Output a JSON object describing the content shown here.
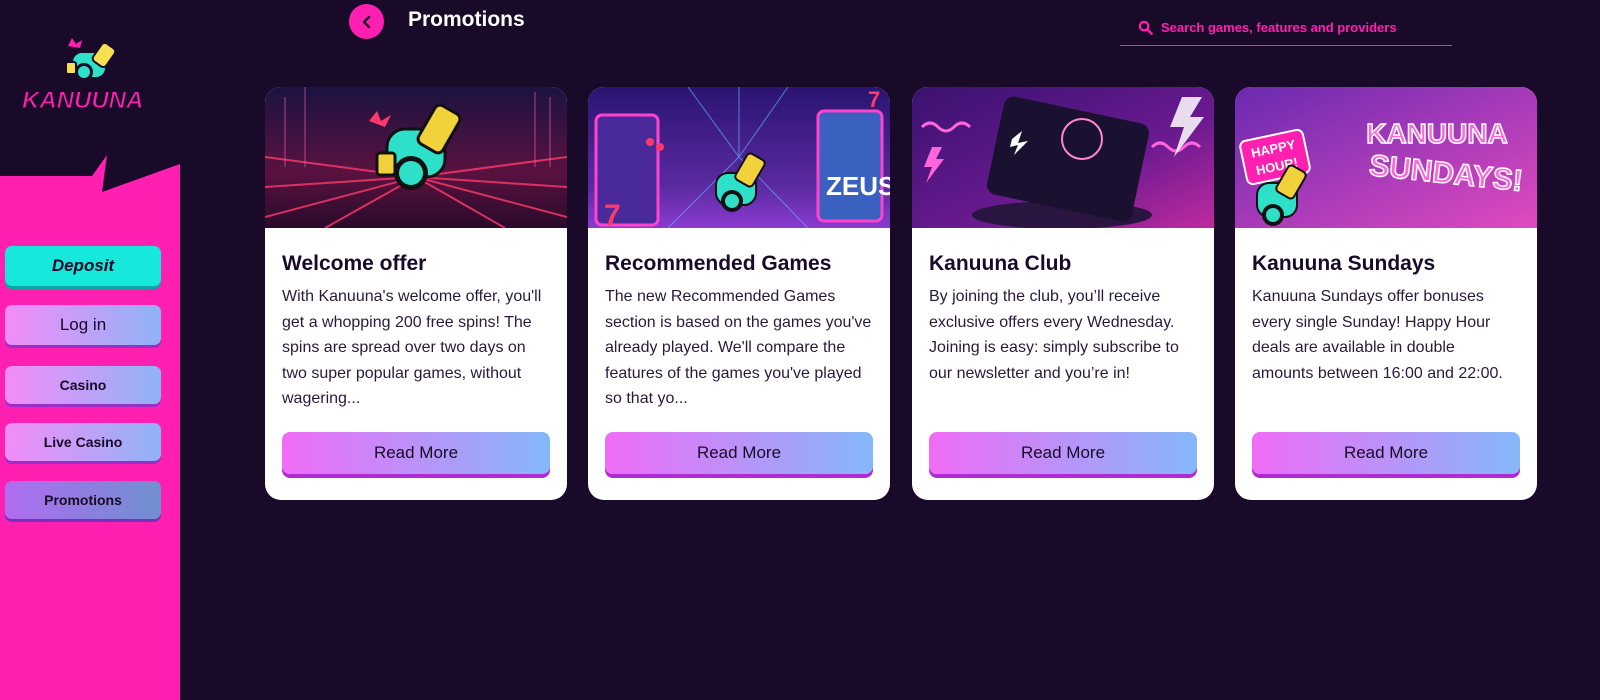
{
  "brand": {
    "logo_text": "KANUUNA"
  },
  "header": {
    "title": "Promotions",
    "search_placeholder": "Search games, features and providers"
  },
  "sidebar": {
    "items": [
      {
        "label": "Deposit"
      },
      {
        "label": "Log in"
      },
      {
        "label": "Casino"
      },
      {
        "label": "Live Casino"
      },
      {
        "label": "Promotions"
      }
    ]
  },
  "cards": [
    {
      "title": "Welcome offer",
      "text": "With Kanuuna's welcome offer, you'll get a whopping 200 free spins! The spins are spread over two days on two super popular games, without wagering...",
      "button": "Read More"
    },
    {
      "title": "Recommended Games",
      "text": "The new Recommended Games section is based on the games you've already played. We'll compare the features of the games you've played so that yo...",
      "button": "Read More"
    },
    {
      "title": "Kanuuna Club",
      "text": "By joining the club, you’ll receive exclusive offers every Wednesday. Joining is easy: simply subscribe to our newsletter and you’re in!",
      "button": "Read More"
    },
    {
      "title": "Kanuuna Sundays",
      "text": "Kanuuna Sundays offer bonuses every single Sunday! Happy Hour deals are available in double amounts between 16:00 and 22:00.",
      "button": "Read More",
      "image_text": [
        "HAPPY",
        "HOUR!",
        "KANUUNA",
        "SUNDAYS!"
      ]
    }
  ],
  "colors": {
    "background": "#1a0a2a",
    "accent_pink": "#ff1fb0",
    "deposit_cyan": "#16e8dc"
  }
}
